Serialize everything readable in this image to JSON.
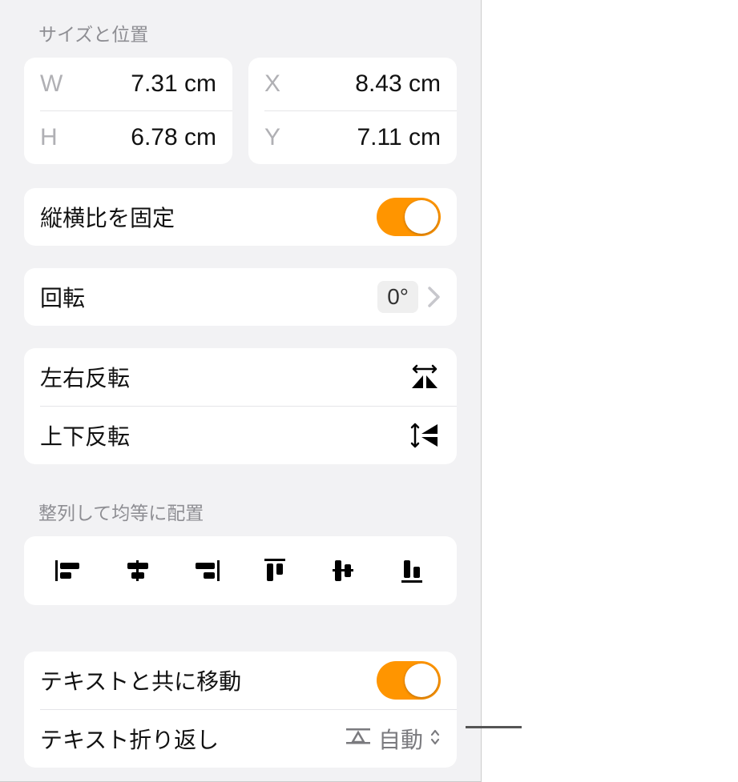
{
  "sections": {
    "size_pos_title": "サイズと位置",
    "align_title": "整列して均等に配置"
  },
  "size": {
    "w_label": "W",
    "w_value": "7.31 cm",
    "h_label": "H",
    "h_value": "6.78 cm",
    "x_label": "X",
    "x_value": "8.43 cm",
    "y_label": "Y",
    "y_value": "7.11 cm"
  },
  "aspect_lock": {
    "label": "縦横比を固定",
    "on": true
  },
  "rotation": {
    "label": "回転",
    "value": "0°"
  },
  "flip": {
    "h_label": "左右反転",
    "v_label": "上下反転"
  },
  "move_with_text": {
    "label": "テキストと共に移動",
    "on": true
  },
  "text_wrap": {
    "label": "テキスト折り返し",
    "value": "自動"
  }
}
